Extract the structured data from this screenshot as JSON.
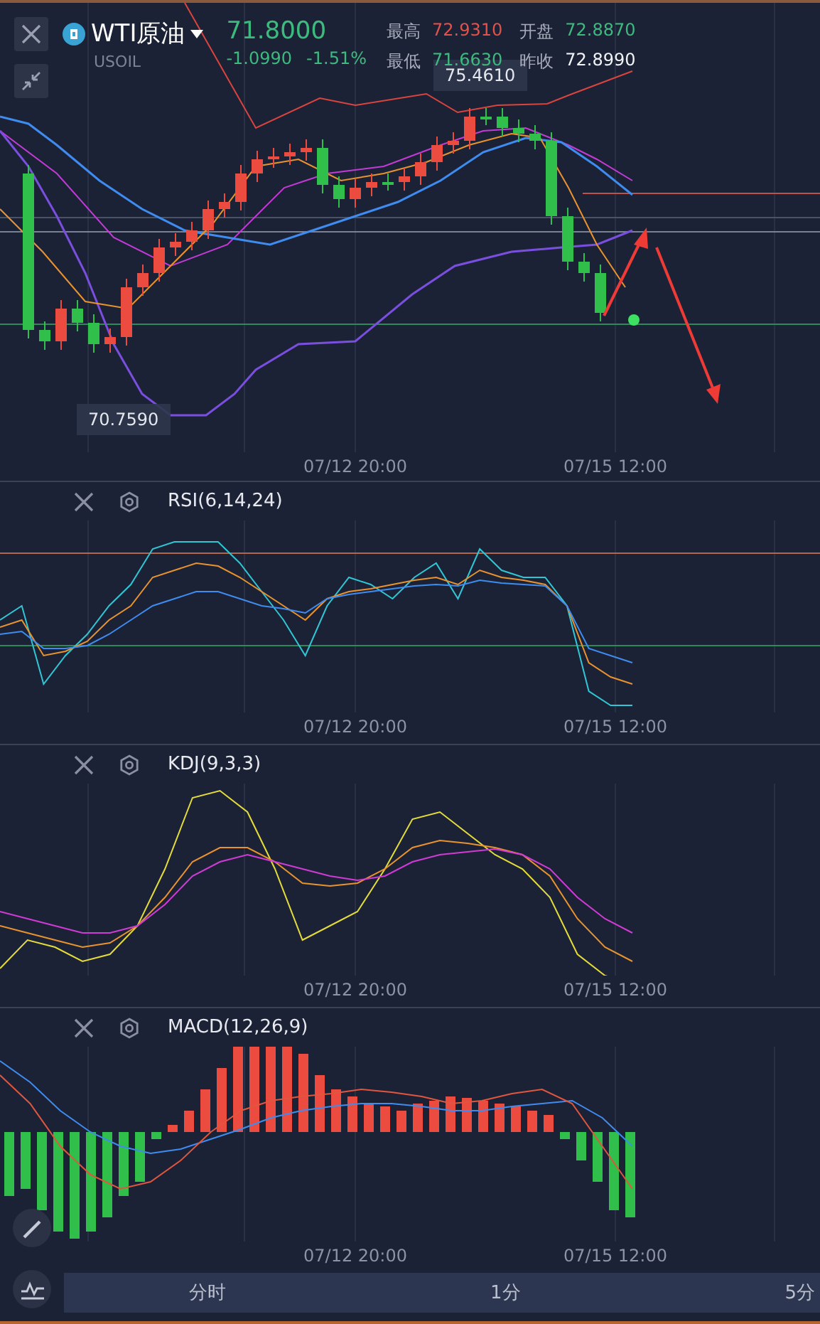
{
  "header": {
    "symbol": "WTI原油",
    "code": "USOIL",
    "price": "71.8000",
    "change": "-1.0990",
    "change_pct": "-1.51%",
    "stats": [
      {
        "label": "最高",
        "value": "72.9310",
        "color": "#e0524a"
      },
      {
        "label": "开盘",
        "value": "72.8870",
        "color": "#3dba7e"
      },
      {
        "label": "最低",
        "value": "71.6630",
        "color": "#3dba7e"
      },
      {
        "label": "昨收",
        "value": "72.8990",
        "color": "#f2f3f6"
      }
    ]
  },
  "main_chart": {
    "high_label": "75.4610",
    "low_label": "70.7590",
    "time_labels": [
      "07/12 20:00",
      "07/15 12:00"
    ]
  },
  "indicators": [
    {
      "name": "RSI(6,14,24)",
      "kind": "rsi",
      "time_labels": [
        "07/12 20:00",
        "07/15 12:00"
      ]
    },
    {
      "name": "KDJ(9,3,3)",
      "kind": "kdj",
      "time_labels": [
        "07/12 20:00",
        "07/15 12:00"
      ]
    },
    {
      "name": "MACD(12,26,9)",
      "kind": "macd",
      "time_labels": [
        "07/12 20:00",
        "07/15 12:00"
      ]
    }
  ],
  "periods": [
    {
      "label": "分时"
    },
    {
      "label": "1分"
    },
    {
      "label": "5分"
    }
  ]
}
